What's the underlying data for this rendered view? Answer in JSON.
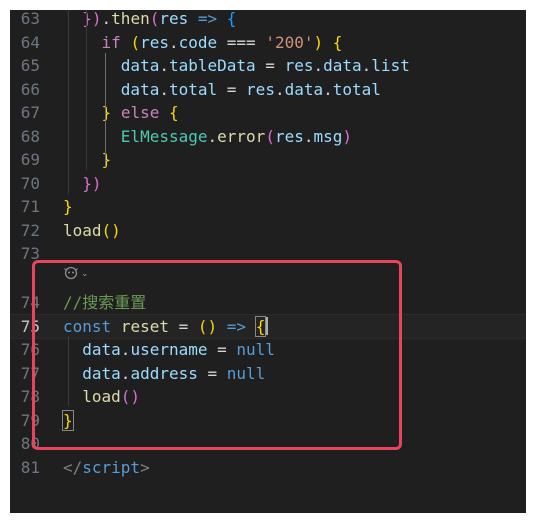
{
  "editor": {
    "lines": [
      {
        "num": "63",
        "tokens": [
          {
            "t": "  })",
            "c": "#da70d6"
          },
          {
            "t": ".",
            "c": "#d4d4d4"
          },
          {
            "t": "then",
            "c": "#dcdcaa"
          },
          {
            "t": "(",
            "c": "#da70d6"
          },
          {
            "t": "res",
            "c": "#9cdcfe"
          },
          {
            "t": " => ",
            "c": "#569cd6"
          },
          {
            "t": "{",
            "c": "#179fff"
          }
        ]
      },
      {
        "num": "64",
        "tokens": [
          {
            "t": "    ",
            "c": "#d4d4d4"
          },
          {
            "t": "if",
            "c": "#c586c0"
          },
          {
            "t": " ",
            "c": "#d4d4d4"
          },
          {
            "t": "(",
            "c": "#ffd700"
          },
          {
            "t": "res",
            "c": "#9cdcfe"
          },
          {
            "t": ".",
            "c": "#d4d4d4"
          },
          {
            "t": "code",
            "c": "#9cdcfe"
          },
          {
            "t": " === ",
            "c": "#d4d4d4"
          },
          {
            "t": "'200'",
            "c": "#ce9178"
          },
          {
            "t": ")",
            "c": "#ffd700"
          },
          {
            "t": " ",
            "c": "#d4d4d4"
          },
          {
            "t": "{",
            "c": "#ffd700"
          }
        ]
      },
      {
        "num": "65",
        "tokens": [
          {
            "t": "      ",
            "c": "#d4d4d4"
          },
          {
            "t": "data",
            "c": "#9cdcfe"
          },
          {
            "t": ".",
            "c": "#d4d4d4"
          },
          {
            "t": "tableData",
            "c": "#9cdcfe"
          },
          {
            "t": " = ",
            "c": "#d4d4d4"
          },
          {
            "t": "res",
            "c": "#9cdcfe"
          },
          {
            "t": ".",
            "c": "#d4d4d4"
          },
          {
            "t": "data",
            "c": "#9cdcfe"
          },
          {
            "t": ".",
            "c": "#d4d4d4"
          },
          {
            "t": "list",
            "c": "#9cdcfe"
          }
        ]
      },
      {
        "num": "66",
        "tokens": [
          {
            "t": "      ",
            "c": "#d4d4d4"
          },
          {
            "t": "data",
            "c": "#9cdcfe"
          },
          {
            "t": ".",
            "c": "#d4d4d4"
          },
          {
            "t": "total",
            "c": "#9cdcfe"
          },
          {
            "t": " = ",
            "c": "#d4d4d4"
          },
          {
            "t": "res",
            "c": "#9cdcfe"
          },
          {
            "t": ".",
            "c": "#d4d4d4"
          },
          {
            "t": "data",
            "c": "#9cdcfe"
          },
          {
            "t": ".",
            "c": "#d4d4d4"
          },
          {
            "t": "total",
            "c": "#9cdcfe"
          }
        ]
      },
      {
        "num": "67",
        "tokens": [
          {
            "t": "    ",
            "c": "#d4d4d4"
          },
          {
            "t": "}",
            "c": "#ffd700"
          },
          {
            "t": " ",
            "c": "#d4d4d4"
          },
          {
            "t": "else",
            "c": "#c586c0"
          },
          {
            "t": " ",
            "c": "#d4d4d4"
          },
          {
            "t": "{",
            "c": "#ffd700"
          }
        ]
      },
      {
        "num": "68",
        "tokens": [
          {
            "t": "      ",
            "c": "#d4d4d4"
          },
          {
            "t": "ElMessage",
            "c": "#4ec9b0"
          },
          {
            "t": ".",
            "c": "#d4d4d4"
          },
          {
            "t": "error",
            "c": "#dcdcaa"
          },
          {
            "t": "(",
            "c": "#da70d6"
          },
          {
            "t": "res",
            "c": "#9cdcfe"
          },
          {
            "t": ".",
            "c": "#d4d4d4"
          },
          {
            "t": "msg",
            "c": "#9cdcfe"
          },
          {
            "t": ")",
            "c": "#da70d6"
          }
        ]
      },
      {
        "num": "69",
        "tokens": [
          {
            "t": "    ",
            "c": "#d4d4d4"
          },
          {
            "t": "}",
            "c": "#ffd700"
          }
        ]
      },
      {
        "num": "70",
        "tokens": [
          {
            "t": "  ",
            "c": "#d4d4d4"
          },
          {
            "t": "})",
            "c": "#da70d6"
          }
        ]
      },
      {
        "num": "71",
        "tokens": [
          {
            "t": "}",
            "c": "#ffd700"
          }
        ]
      },
      {
        "num": "72",
        "tokens": [
          {
            "t": "load",
            "c": "#dcdcaa"
          },
          {
            "t": "()",
            "c": "#ffd700"
          }
        ]
      },
      {
        "num": "74",
        "tokens": [
          {
            "t": "//搜索重置",
            "c": "#6a9955"
          }
        ]
      },
      {
        "num": "75",
        "tokens": [
          {
            "t": "const",
            "c": "#569cd6"
          },
          {
            "t": " ",
            "c": "#d4d4d4"
          },
          {
            "t": "reset",
            "c": "#dcdcaa"
          },
          {
            "t": " = ",
            "c": "#d4d4d4"
          },
          {
            "t": "()",
            "c": "#ffd700"
          },
          {
            "t": " => ",
            "c": "#569cd6"
          },
          {
            "t": "{",
            "c": "#ffd700",
            "match": true
          }
        ],
        "current": true,
        "cursor": true
      },
      {
        "num": "76",
        "tokens": [
          {
            "t": "  ",
            "c": "#d4d4d4"
          },
          {
            "t": "data",
            "c": "#9cdcfe"
          },
          {
            "t": ".",
            "c": "#d4d4d4"
          },
          {
            "t": "username",
            "c": "#9cdcfe"
          },
          {
            "t": " = ",
            "c": "#d4d4d4"
          },
          {
            "t": "null",
            "c": "#569cd6"
          }
        ]
      },
      {
        "num": "77",
        "tokens": [
          {
            "t": "  ",
            "c": "#d4d4d4"
          },
          {
            "t": "data",
            "c": "#9cdcfe"
          },
          {
            "t": ".",
            "c": "#d4d4d4"
          },
          {
            "t": "address",
            "c": "#9cdcfe"
          },
          {
            "t": " = ",
            "c": "#d4d4d4"
          },
          {
            "t": "null",
            "c": "#569cd6"
          }
        ]
      },
      {
        "num": "78",
        "tokens": [
          {
            "t": "  ",
            "c": "#d4d4d4"
          },
          {
            "t": "load",
            "c": "#dcdcaa"
          },
          {
            "t": "()",
            "c": "#da70d6"
          }
        ]
      },
      {
        "num": "79",
        "tokens": [
          {
            "t": "}",
            "c": "#ffd700",
            "match": true
          }
        ]
      },
      {
        "num": "80",
        "tokens": []
      },
      {
        "num": "81",
        "tokens": [
          {
            "t": "</",
            "c": "#808080"
          },
          {
            "t": "script",
            "c": "#569cd6"
          },
          {
            "t": ">",
            "c": "#808080"
          }
        ]
      }
    ],
    "blank_line_num": "73",
    "codelens_icon": "copilot-icon"
  },
  "colors": {
    "background": "#1f1f1f",
    "highlight_box": "#e8455a",
    "line_number": "#6e7681"
  }
}
